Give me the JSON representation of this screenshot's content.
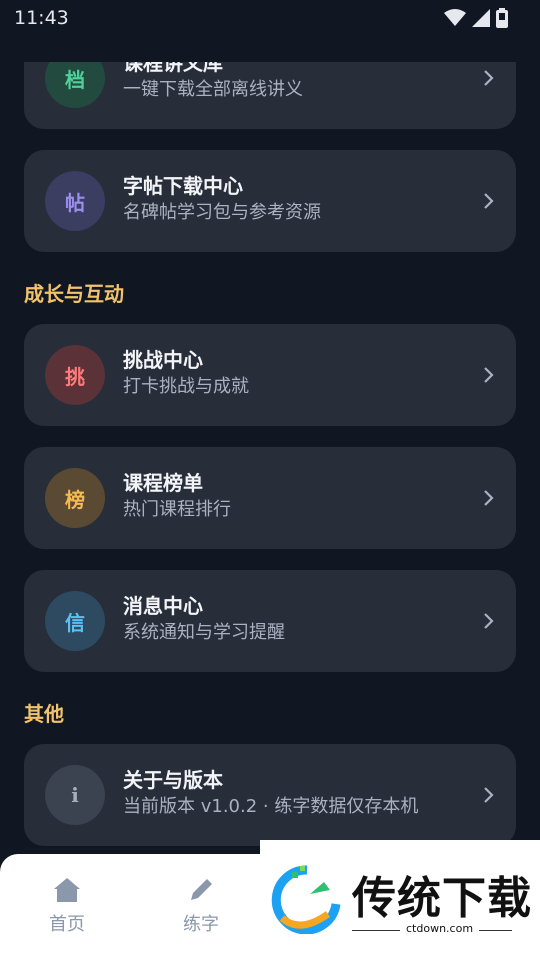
{
  "status_bar": {
    "time": "11:43"
  },
  "cards": [
    {
      "badge": "档",
      "title": "课程讲义库",
      "subtitle": "一键下载全部离线讲义",
      "badge_bg": "#234a3f",
      "badge_fg": "#4fd29a"
    },
    {
      "badge": "帖",
      "title": "字帖下载中心",
      "subtitle": "名碑帖学习包与参考资源",
      "badge_bg": "#3b3d61",
      "badge_fg": "#9c8ef0"
    },
    {
      "badge": "挑",
      "title": "挑战中心",
      "subtitle": "打卡挑战与成就",
      "badge_bg": "#5a3238",
      "badge_fg": "#ff7a7a"
    },
    {
      "badge": "榜",
      "title": "课程榜单",
      "subtitle": "热门课程排行",
      "badge_bg": "#5a4a33",
      "badge_fg": "#f4bb52"
    },
    {
      "badge": "信",
      "title": "消息中心",
      "subtitle": "系统通知与学习提醒",
      "badge_bg": "#2d4a60",
      "badge_fg": "#5cc0f2"
    },
    {
      "badge": "i",
      "title": "关于与版本",
      "subtitle": "当前版本 v1.0.2 · 练字数据仅存本机",
      "badge_bg": "#3c4350",
      "badge_fg": "#a6afbd"
    }
  ],
  "sections": {
    "growth": "成长与互动",
    "other": "其他"
  },
  "tabs": [
    {
      "label": "首页",
      "icon": "home-icon"
    },
    {
      "label": "练字",
      "icon": "pencil-icon"
    }
  ],
  "watermark": {
    "title": "传统下载",
    "domain": "ctdown.com"
  }
}
